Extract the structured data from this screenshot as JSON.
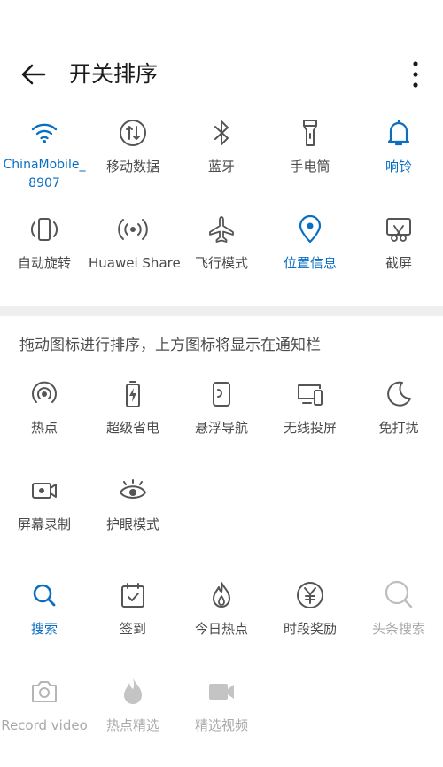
{
  "header": {
    "title": "开关排序"
  },
  "colors": {
    "active": "#0a6fc2",
    "normal": "#4a4a4a",
    "inactive": "#a9a9a9",
    "divider": "#efefef"
  },
  "active_row1": [
    {
      "label": "ChinaMobile_8907",
      "icon": "wifi-icon",
      "state": "active"
    },
    {
      "label": "移动数据",
      "icon": "mobile-data-icon",
      "state": "normal"
    },
    {
      "label": "蓝牙",
      "icon": "bluetooth-icon",
      "state": "normal"
    },
    {
      "label": "手电筒",
      "icon": "flashlight-icon",
      "state": "normal"
    },
    {
      "label": "响铃",
      "icon": "bell-icon",
      "state": "active"
    }
  ],
  "active_row2": [
    {
      "label": "自动旋转",
      "icon": "auto-rotate-icon",
      "state": "normal"
    },
    {
      "label": "Huawei Share",
      "icon": "huawei-share-icon",
      "state": "normal"
    },
    {
      "label": "飞行模式",
      "icon": "airplane-icon",
      "state": "normal"
    },
    {
      "label": "位置信息",
      "icon": "location-icon",
      "state": "active"
    },
    {
      "label": "截屏",
      "icon": "screenshot-icon",
      "state": "normal"
    }
  ],
  "hint": "拖动图标进行排序，上方图标将显示在通知栏",
  "available_row1": [
    {
      "label": "热点",
      "icon": "hotspot-icon",
      "state": "normal"
    },
    {
      "label": "超级省电",
      "icon": "power-saving-icon",
      "state": "normal"
    },
    {
      "label": "悬浮导航",
      "icon": "floating-nav-icon",
      "state": "normal"
    },
    {
      "label": "无线投屏",
      "icon": "wireless-projection-icon",
      "state": "normal"
    },
    {
      "label": "免打扰",
      "icon": "moon-icon",
      "state": "normal"
    }
  ],
  "available_row2": [
    {
      "label": "屏幕录制",
      "icon": "screen-record-icon",
      "state": "normal"
    },
    {
      "label": "护眼模式",
      "icon": "eye-comfort-icon",
      "state": "normal"
    }
  ],
  "available_row3": [
    {
      "label": "搜索",
      "icon": "search-icon",
      "state": "active"
    },
    {
      "label": "签到",
      "icon": "check-in-icon",
      "state": "normal"
    },
    {
      "label": "今日热点",
      "icon": "flame-icon",
      "state": "normal"
    },
    {
      "label": "时段奖励",
      "icon": "yuan-coin-icon",
      "state": "normal"
    },
    {
      "label": "头条搜索",
      "icon": "search-gray-icon",
      "state": "inactive"
    }
  ],
  "available_row4": [
    {
      "label": "Record video",
      "icon": "camera-icon",
      "state": "inactive"
    },
    {
      "label": "热点精选",
      "icon": "flame-filled-icon",
      "state": "inactive"
    },
    {
      "label": "精选视频",
      "icon": "video-camera-icon",
      "state": "inactive"
    }
  ]
}
